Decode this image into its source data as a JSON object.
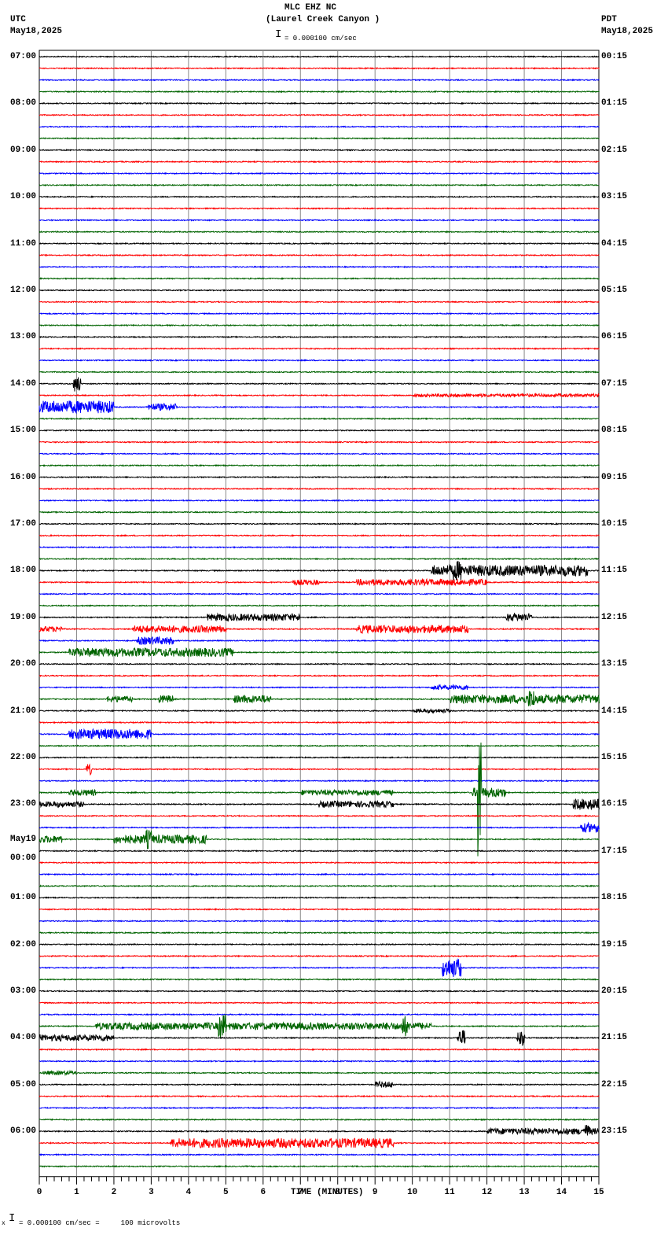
{
  "header": {
    "station": "MLC EHZ NC",
    "location": "(Laurel Creek Canyon )",
    "scale": "= 0.000100 cm/sec",
    "left_tz": "UTC",
    "left_date": "May18,2025",
    "right_tz": "PDT",
    "right_date": "May18,2025"
  },
  "footer": {
    "scale": "= 0.000100 cm/sec =     100 microvolts",
    "mark": "x"
  },
  "chart_data": {
    "type": "line",
    "title": "MLC EHZ NC (Laurel Creek Canyon )",
    "xlabel": "TIME (MINUTES)",
    "xlim": [
      0,
      15
    ],
    "x_ticks": [
      "0",
      "1",
      "2",
      "3",
      "4",
      "5",
      "6",
      "7",
      "8",
      "9",
      "10",
      "11",
      "12",
      "13",
      "14",
      "15"
    ],
    "trace_colors": [
      "#000000",
      "#ff0000",
      "#0000ff",
      "#006400"
    ],
    "traces_per_hour": 4,
    "left_labels": [
      "07:00",
      "08:00",
      "09:00",
      "10:00",
      "11:00",
      "12:00",
      "13:00",
      "14:00",
      "15:00",
      "16:00",
      "17:00",
      "18:00",
      "19:00",
      "20:00",
      "21:00",
      "22:00",
      "23:00",
      "00:00",
      "01:00",
      "02:00",
      "03:00",
      "04:00",
      "05:00",
      "06:00"
    ],
    "left_date_change": {
      "hour_index": 17,
      "label": "May19"
    },
    "right_labels": [
      "00:15",
      "01:15",
      "02:15",
      "03:15",
      "04:15",
      "05:15",
      "06:15",
      "07:15",
      "08:15",
      "09:15",
      "10:15",
      "11:15",
      "12:15",
      "13:15",
      "14:15",
      "15:15",
      "16:15",
      "17:15",
      "18:15",
      "19:15",
      "20:15",
      "21:15",
      "22:15",
      "23:15"
    ],
    "events": [
      {
        "trace": 28,
        "start": 0.9,
        "end": 1.1,
        "amp": 20
      },
      {
        "trace": 29,
        "start": 10,
        "end": 15,
        "amp": 4
      },
      {
        "trace": 30,
        "start": 0,
        "end": 2,
        "amp": 16
      },
      {
        "trace": 30,
        "start": 2.9,
        "end": 3.7,
        "amp": 9
      },
      {
        "trace": 44,
        "start": 10.5,
        "end": 14.7,
        "amp": 14
      },
      {
        "trace": 44,
        "start": 11.1,
        "end": 11.3,
        "amp": 26
      },
      {
        "trace": 45,
        "start": 6.8,
        "end": 7.5,
        "amp": 7
      },
      {
        "trace": 45,
        "start": 8.5,
        "end": 12,
        "amp": 8
      },
      {
        "trace": 48,
        "start": 4.5,
        "end": 7,
        "amp": 9
      },
      {
        "trace": 48,
        "start": 12.5,
        "end": 13.2,
        "amp": 10
      },
      {
        "trace": 49,
        "start": 0,
        "end": 0.6,
        "amp": 7
      },
      {
        "trace": 49,
        "start": 2.5,
        "end": 5,
        "amp": 9
      },
      {
        "trace": 49,
        "start": 8.5,
        "end": 11.5,
        "amp": 10
      },
      {
        "trace": 50,
        "start": 2.6,
        "end": 3.6,
        "amp": 10
      },
      {
        "trace": 51,
        "start": 0.8,
        "end": 5.2,
        "amp": 11
      },
      {
        "trace": 54,
        "start": 10.5,
        "end": 11.5,
        "amp": 6
      },
      {
        "trace": 55,
        "start": 1.8,
        "end": 2.5,
        "amp": 8
      },
      {
        "trace": 55,
        "start": 3.2,
        "end": 3.6,
        "amp": 10
      },
      {
        "trace": 55,
        "start": 5.2,
        "end": 6.2,
        "amp": 10
      },
      {
        "trace": 55,
        "start": 11,
        "end": 15,
        "amp": 11
      },
      {
        "trace": 55,
        "start": 13.1,
        "end": 13.3,
        "amp": 24
      },
      {
        "trace": 56,
        "start": 10,
        "end": 11,
        "amp": 5
      },
      {
        "trace": 58,
        "start": 0.8,
        "end": 3,
        "amp": 13
      },
      {
        "trace": 61,
        "start": 1.25,
        "end": 1.4,
        "amp": 14
      },
      {
        "trace": 63,
        "start": 0.8,
        "end": 1.5,
        "amp": 8
      },
      {
        "trace": 63,
        "start": 7,
        "end": 9.5,
        "amp": 7
      },
      {
        "trace": 63,
        "start": 11.6,
        "end": 12.5,
        "amp": 12
      },
      {
        "trace": 63,
        "start": 11.75,
        "end": 11.85,
        "amp": 190
      },
      {
        "trace": 64,
        "start": 0,
        "end": 1.2,
        "amp": 7
      },
      {
        "trace": 64,
        "start": 7.5,
        "end": 9.5,
        "amp": 8
      },
      {
        "trace": 64,
        "start": 14.3,
        "end": 15,
        "amp": 14
      },
      {
        "trace": 66,
        "start": 14.5,
        "end": 15,
        "amp": 12
      },
      {
        "trace": 67,
        "start": 0,
        "end": 0.6,
        "amp": 9
      },
      {
        "trace": 67,
        "start": 2,
        "end": 4.5,
        "amp": 11
      },
      {
        "trace": 67,
        "start": 2.85,
        "end": 3.0,
        "amp": 25
      },
      {
        "trace": 78,
        "start": 10.8,
        "end": 11.3,
        "amp": 24
      },
      {
        "trace": 83,
        "start": 1.5,
        "end": 10.5,
        "amp": 9
      },
      {
        "trace": 83,
        "start": 4.8,
        "end": 5.0,
        "amp": 32
      },
      {
        "trace": 83,
        "start": 9.7,
        "end": 9.9,
        "amp": 26
      },
      {
        "trace": 84,
        "start": 0,
        "end": 2,
        "amp": 8
      },
      {
        "trace": 84,
        "start": 11.2,
        "end": 11.4,
        "amp": 20
      },
      {
        "trace": 84,
        "start": 12.8,
        "end": 13.0,
        "amp": 20
      },
      {
        "trace": 87,
        "start": 0.1,
        "end": 1,
        "amp": 5
      },
      {
        "trace": 88,
        "start": 9,
        "end": 9.5,
        "amp": 8
      },
      {
        "trace": 92,
        "start": 12,
        "end": 15,
        "amp": 8
      },
      {
        "trace": 92,
        "start": 14.6,
        "end": 14.75,
        "amp": 18
      },
      {
        "trace": 93,
        "start": 3.5,
        "end": 9.5,
        "amp": 12
      }
    ]
  }
}
